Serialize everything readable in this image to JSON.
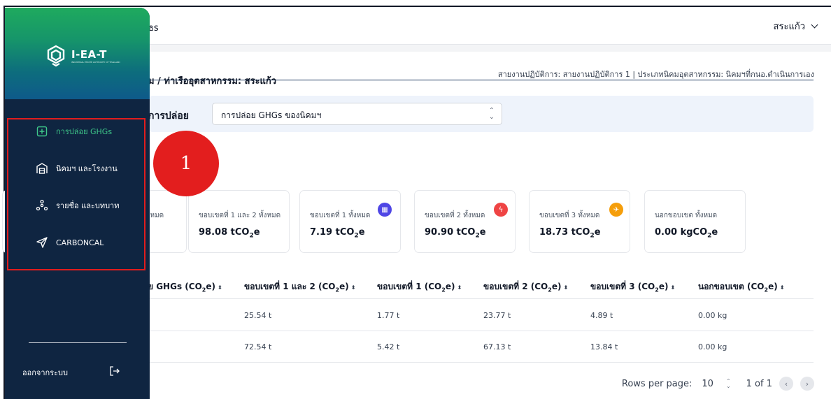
{
  "appbar": {
    "title": "GHGs",
    "title_visible": "ธs",
    "user": "สระแก้ว",
    "chevron_icon": "chevron-down-icon"
  },
  "breadcrumb": "นิคมฯ / ท่าเรืออุตสาหกรรม: สระแก้ว",
  "breadcrumb_visible": "ม / ท่าเรืออุตสาหกรรม: สระแก้ว",
  "meta": "สายงานปฏิบัติการ: สายงานปฏิบัติการ 1 | ประเภทนิคมอุตสาหกรรม: นิคมฯที่กนอ.ดำเนินการเอง",
  "filter": {
    "label": "ประเภทการปล่อย",
    "label_visible": "การปล่อย",
    "selected": "การปล่อย GHGs ของนิคมฯ",
    "caret_up": "⌃",
    "caret_down": "⌄"
  },
  "cards": [
    {
      "label": "ทั้งหมด",
      "label_visible": "ทั้งหมด",
      "value": ""
    },
    {
      "label": "ขอบเขตที่ 1 และ 2 ทั้งหมด",
      "value": "98.08 tCO",
      "value_suffix": "e",
      "icon": ""
    },
    {
      "label": "ขอบเขตที่ 1 ทั้งหมด",
      "value": "7.19 tCO",
      "value_suffix": "e",
      "icon": "factory-icon",
      "color": "#4f46e5"
    },
    {
      "label": "ขอบเขตที่ 2 ทั้งหมด",
      "value": "90.90 tCO",
      "value_suffix": "e",
      "icon": "lightning-icon",
      "color": "#ef4444"
    },
    {
      "label": "ขอบเขตที่ 3 ทั้งหมด",
      "value": "18.73 tCO",
      "value_suffix": "e",
      "icon": "plane-icon",
      "color": "#f59e0b"
    },
    {
      "label": "นอกขอบเขต ทั้งหมด",
      "value": "0.00 kgCO",
      "value_suffix": "e",
      "icon": ""
    }
  ],
  "table": {
    "headers": [
      {
        "label": "ปริมาณการปล่อย GHGs (CO",
        "label_visible": "ย GHGs (CO",
        "suffix": "e)"
      },
      {
        "label": "ขอบเขตที่ 1 และ 2 (CO",
        "suffix": "e)"
      },
      {
        "label": "ขอบเขตที่ 1 (CO",
        "suffix": "e)"
      },
      {
        "label": "ขอบเขตที่ 2 (CO",
        "suffix": "e)"
      },
      {
        "label": "ขอบเขตที่ 3 (CO",
        "suffix": "e)"
      },
      {
        "label": "นอกขอบเขต (CO",
        "suffix": "e)"
      }
    ],
    "sort_glyph": "⬍",
    "rows": [
      {
        "cells": [
          "25.54 t",
          "1.77 t",
          "23.77 t",
          "4.89 t",
          "0.00 kg"
        ]
      },
      {
        "cells": [
          "72.54 t",
          "5.42 t",
          "67.13 t",
          "13.84 t",
          "0.00 kg"
        ]
      }
    ]
  },
  "pagination": {
    "rows_label": "Rows per page:",
    "rows_value": "10",
    "page_info": "1 of 1",
    "prev": "‹",
    "next": "›"
  },
  "sidebar": {
    "logo_text": "I-EA-T",
    "logo_sub": "INDUSTRIAL ESTATE AUTHORITY OF THAILAND",
    "items": [
      {
        "label": "การปล่อย GHGs",
        "icon": "plus-square-icon",
        "active": true
      },
      {
        "label": "นิคมฯ และโรงงาน",
        "icon": "warehouse-icon",
        "active": false
      },
      {
        "label": "รายชื่อ และบทบาท",
        "icon": "users-network-icon",
        "active": false
      },
      {
        "label": "CARBONCAL",
        "icon": "send-icon",
        "active": false
      }
    ],
    "logout": "ออกจากระบบ",
    "logout_icon": "logout-icon"
  },
  "annotation": {
    "number": "1",
    "color": "#e31e1e"
  },
  "colors": {
    "sidebar": "#0f2541",
    "accent": "#3fc98a",
    "highlight": "#e11d1d"
  }
}
